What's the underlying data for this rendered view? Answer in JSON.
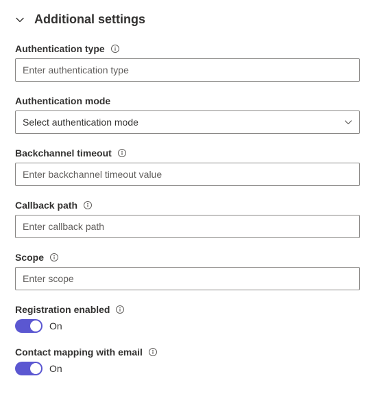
{
  "section": {
    "title": "Additional settings"
  },
  "fields": {
    "authType": {
      "label": "Authentication type",
      "placeholder": "Enter authentication type",
      "value": ""
    },
    "authMode": {
      "label": "Authentication mode",
      "selected": "Select authentication mode"
    },
    "bcTimeout": {
      "label": "Backchannel timeout",
      "placeholder": "Enter backchannel timeout value",
      "value": ""
    },
    "callback": {
      "label": "Callback path",
      "placeholder": "Enter callback path",
      "value": ""
    },
    "scope": {
      "label": "Scope",
      "placeholder": "Enter scope",
      "value": ""
    },
    "regEnabled": {
      "label": "Registration enabled",
      "state": "On"
    },
    "contactMap": {
      "label": "Contact mapping with email",
      "state": "On"
    }
  }
}
